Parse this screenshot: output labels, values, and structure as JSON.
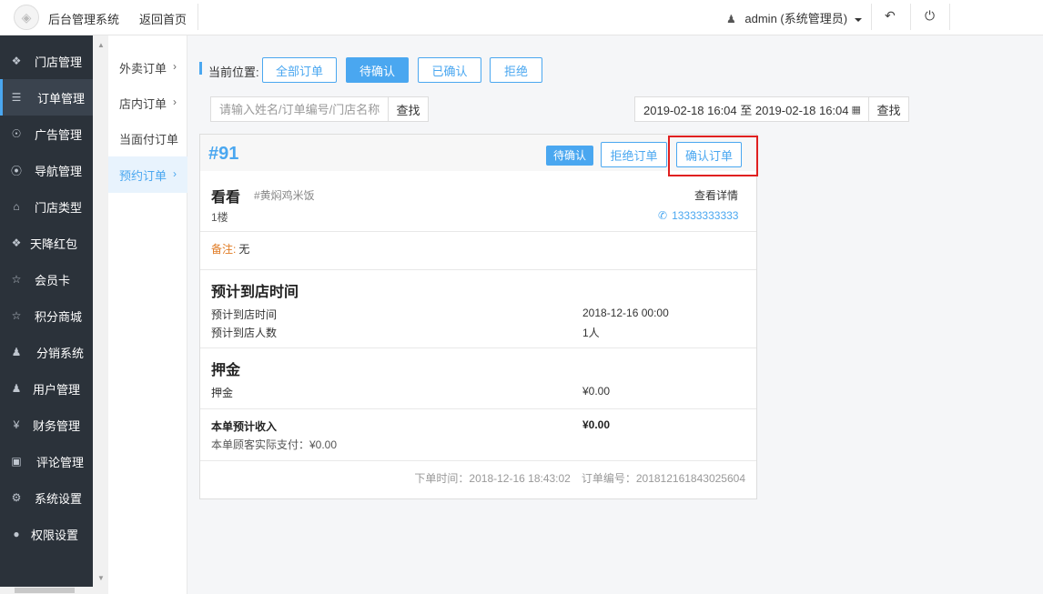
{
  "header": {
    "app_title": "后台管理系统",
    "back_home": "返回首页",
    "user_label": "admin (系统管理员)",
    "logo_icon": "logo-icon",
    "back_icon": "undo-icon",
    "power_icon": "power-icon"
  },
  "sidebar": {
    "items": [
      {
        "label": "门店管理",
        "icon": "cubes-icon"
      },
      {
        "label": "订单管理",
        "icon": "bars-icon"
      },
      {
        "label": "广告管理",
        "icon": "lifebuoy-icon"
      },
      {
        "label": "导航管理",
        "icon": "compass-icon"
      },
      {
        "label": "门店类型",
        "icon": "bank-icon"
      },
      {
        "label": "天降红包",
        "icon": "cubes-icon"
      },
      {
        "label": "会员卡",
        "icon": "star-icon"
      },
      {
        "label": "积分商城",
        "icon": "star-icon"
      },
      {
        "label": "分销系统",
        "icon": "users-icon"
      },
      {
        "label": "用户管理",
        "icon": "user-icon"
      },
      {
        "label": "财务管理",
        "icon": "yen-icon"
      },
      {
        "label": "评论管理",
        "icon": "money-icon"
      },
      {
        "label": "系统设置",
        "icon": "gear-icon"
      },
      {
        "label": "权限设置",
        "icon": "lock-icon"
      }
    ]
  },
  "subnav": {
    "items": [
      {
        "label": "外卖订单",
        "chev": "›"
      },
      {
        "label": "店内订单",
        "chev": "›"
      },
      {
        "label": "当面付订单",
        "chev": ""
      },
      {
        "label": "预约订单",
        "chev": "›"
      }
    ]
  },
  "filters": {
    "breadcrumb_label": "当前位置:",
    "tabs": [
      "全部订单",
      "待确认",
      "已确认",
      "拒绝"
    ],
    "search_placeholder": "请输入姓名/订单编号/门店名称",
    "search_button": "查找",
    "date_range": "2019-02-18 16:04 至 2019-02-18 16:04",
    "date_button": "查找"
  },
  "order": {
    "number": "#91",
    "status": "待确认",
    "reject_button": "拒绝订单",
    "confirm_button": "确认订单",
    "customer_name": "看看",
    "store_tag": "#黄焖鸡米饭",
    "detail_link": "查看详情",
    "location": "1楼",
    "phone": "13333333333",
    "remark_label": "备注:",
    "remark_value": "无",
    "arrival_section": "预计到店时间",
    "arrival_time_label": "预计到店时间",
    "arrival_time_value": "2018-12-16 00:00",
    "arrival_people_label": "预计到店人数",
    "arrival_people_value": "1人",
    "deposit_section": "押金",
    "deposit_label": "押金",
    "deposit_value": "¥0.00",
    "income_label": "本单预计收入",
    "income_value": "¥0.00",
    "actual_paid": "本单顾客实际支付：¥0.00",
    "order_time": "下单时间：2018-12-16 18:43:02",
    "order_serial": "订单编号：201812161843025604"
  },
  "colors": {
    "accent": "#4aa7f0",
    "sidebar_bg": "#2b323a",
    "remark": "#e07b24",
    "highlight": "#e02020"
  }
}
